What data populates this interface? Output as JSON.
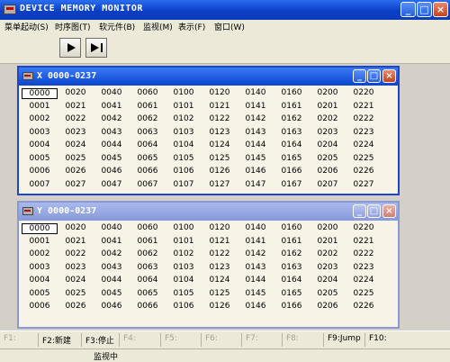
{
  "app": {
    "title": "DEVICE MEMORY MONITOR"
  },
  "menu": [
    "菜单起动(S)",
    "时序图(T)",
    "软元件(B)",
    "监视(M)",
    "表示(F)",
    "窗口(W)"
  ],
  "windows": [
    {
      "title": "X   0000-0237",
      "rows": [
        [
          "0000",
          "0020",
          "0040",
          "0060",
          "0100",
          "0120",
          "0140",
          "0160",
          "0200",
          "0220"
        ],
        [
          "0001",
          "0021",
          "0041",
          "0061",
          "0101",
          "0121",
          "0141",
          "0161",
          "0201",
          "0221"
        ],
        [
          "0002",
          "0022",
          "0042",
          "0062",
          "0102",
          "0122",
          "0142",
          "0162",
          "0202",
          "0222"
        ],
        [
          "0003",
          "0023",
          "0043",
          "0063",
          "0103",
          "0123",
          "0143",
          "0163",
          "0203",
          "0223"
        ],
        [
          "0004",
          "0024",
          "0044",
          "0064",
          "0104",
          "0124",
          "0144",
          "0164",
          "0204",
          "0224"
        ],
        [
          "0005",
          "0025",
          "0045",
          "0065",
          "0105",
          "0125",
          "0145",
          "0165",
          "0205",
          "0225"
        ],
        [
          "0006",
          "0026",
          "0046",
          "0066",
          "0106",
          "0126",
          "0146",
          "0166",
          "0206",
          "0226"
        ],
        [
          "0007",
          "0027",
          "0047",
          "0067",
          "0107",
          "0127",
          "0147",
          "0167",
          "0207",
          "0227"
        ]
      ]
    },
    {
      "title": "Y   0000-0237",
      "rows": [
        [
          "0000",
          "0020",
          "0040",
          "0060",
          "0100",
          "0120",
          "0140",
          "0160",
          "0200",
          "0220"
        ],
        [
          "0001",
          "0021",
          "0041",
          "0061",
          "0101",
          "0121",
          "0141",
          "0161",
          "0201",
          "0221"
        ],
        [
          "0002",
          "0022",
          "0042",
          "0062",
          "0102",
          "0122",
          "0142",
          "0162",
          "0202",
          "0222"
        ],
        [
          "0003",
          "0023",
          "0043",
          "0063",
          "0103",
          "0123",
          "0143",
          "0163",
          "0203",
          "0223"
        ],
        [
          "0004",
          "0024",
          "0044",
          "0064",
          "0104",
          "0124",
          "0144",
          "0164",
          "0204",
          "0224"
        ],
        [
          "0005",
          "0025",
          "0045",
          "0065",
          "0105",
          "0125",
          "0145",
          "0165",
          "0205",
          "0225"
        ],
        [
          "0006",
          "0026",
          "0046",
          "0066",
          "0106",
          "0126",
          "0146",
          "0166",
          "0206",
          "0226"
        ]
      ]
    }
  ],
  "fkeys": [
    {
      "label": "F1:",
      "enabled": false
    },
    {
      "label": "F2:新建",
      "enabled": true
    },
    {
      "label": "F3:停止",
      "enabled": true
    },
    {
      "label": "F4:",
      "enabled": false
    },
    {
      "label": "F5:",
      "enabled": false
    },
    {
      "label": "F6:",
      "enabled": false
    },
    {
      "label": "F7:",
      "enabled": false
    },
    {
      "label": "F8:",
      "enabled": false
    },
    {
      "label": "F9:Jump",
      "enabled": true
    },
    {
      "label": "F10:",
      "enabled": true
    }
  ],
  "status": "监视中"
}
